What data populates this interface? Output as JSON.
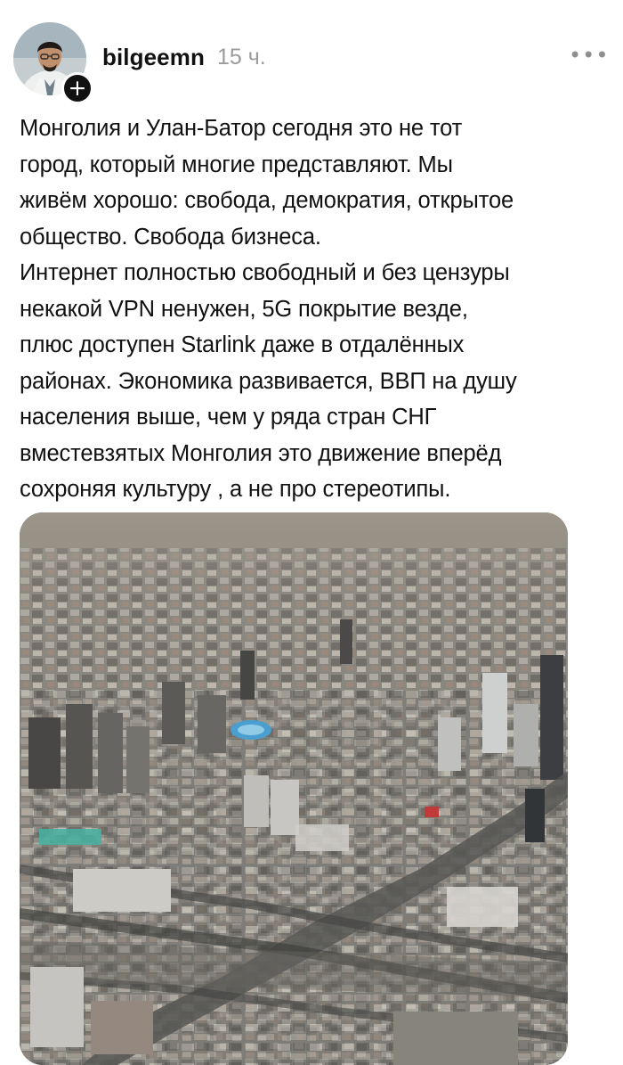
{
  "post": {
    "author": {
      "username": "bilgeemn",
      "avatar_icon": "avatar-photo",
      "follow_icon": "plus-icon",
      "follow_glyph": "+"
    },
    "time_ago": "15 ч.",
    "more_glyph": "•••",
    "paragraphs": [
      "Монголия и Улан-Батор сегодня это не тот\nгород, который многие представляют. Мы\nживём хорошо: свобода, демократия, открытое\nобщество. Свобода бизнеса.",
      "Интернет полностью свободный и без цензуры\nнекакой VPN ненужен, 5G покрытие везде,\nплюс доступен Starlink даже в отдалённых\nрайонах. Экономика развивается, ВВП на душу\nнаселения выше, чем у ряда стран СНГ\nвместевзятых Монголия это движение вперёд\nсохроняя культуру , а не про стереотипы."
    ],
    "media": {
      "type": "photo",
      "subject": "aerial-city-photo"
    }
  },
  "colors": {
    "text": "#111111",
    "muted": "#9b9b9b",
    "badge": "#111111",
    "background": "#ffffff"
  }
}
